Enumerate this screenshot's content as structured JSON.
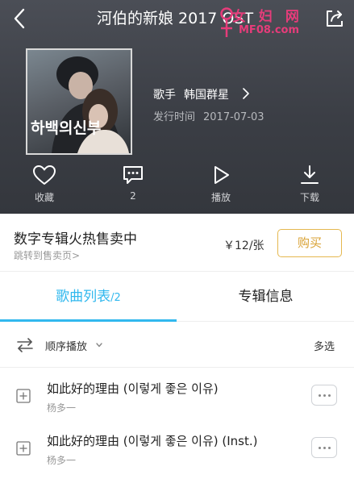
{
  "header": {
    "title": "河伯的新娘 2017 OST",
    "back_icon": "chevron-left-icon",
    "share_icon": "share-icon"
  },
  "watermark": {
    "line1": "女 妇 网",
    "line2": "MF08.com",
    "color": "#e63c7a"
  },
  "album": {
    "cover_text": "하백의신부",
    "artist_key": "歌手",
    "artist_value": "韩国群星",
    "release_key": "发行时间",
    "release_value": "2017-07-03"
  },
  "actions": [
    {
      "label": "收藏",
      "icon": "heart-icon"
    },
    {
      "label": "2",
      "icon": "comment-icon"
    },
    {
      "label": "播放",
      "icon": "play-icon"
    },
    {
      "label": "下载",
      "icon": "download-icon"
    }
  ],
  "purchase": {
    "title": "数字专辑火热售卖中",
    "subtitle": "跳转到售卖页>",
    "price": "￥12/张",
    "button": "购买",
    "accent": "#d9a234"
  },
  "tabs": {
    "songs_label": "歌曲列表",
    "songs_count": "/2",
    "info_label": "专辑信息",
    "active_color": "#31b8ee"
  },
  "playbar": {
    "order_label": "顺序播放",
    "multi_label": "多选"
  },
  "songs": [
    {
      "title": "如此好的理由 (이렇게 좋은 이유)",
      "artist": "杨多一"
    },
    {
      "title": "如此好的理由 (이렇게 좋은 이유) (Inst.)",
      "artist": "杨多一"
    }
  ]
}
